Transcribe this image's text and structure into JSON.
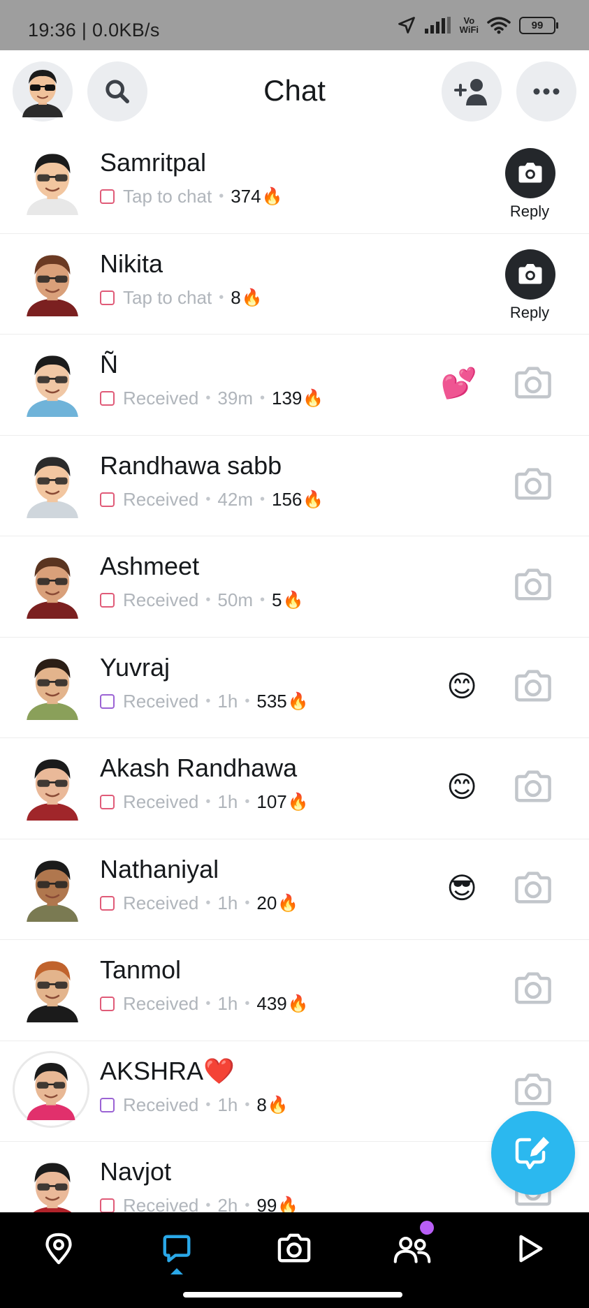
{
  "status_bar": {
    "time": "19:36 | 0.0KB/s",
    "vowifi": "Vo\nWiFi",
    "battery": "99"
  },
  "header": {
    "title": "Chat"
  },
  "chats": [
    {
      "name": "Samritpal",
      "status": "Tap to chat",
      "time": "",
      "streak": "374",
      "action": "reply",
      "emoji": "",
      "box_color": "red",
      "avatar_skin": "#f2c6a0",
      "avatar_hair": "#1b1b1b",
      "avatar_shirt": "#e8e8e8"
    },
    {
      "name": "Nikita",
      "status": "Tap to chat",
      "time": "",
      "streak": "8",
      "action": "reply",
      "emoji": "",
      "box_color": "red",
      "avatar_skin": "#d9a07a",
      "avatar_hair": "#6b3a23",
      "avatar_shirt": "#7b2020"
    },
    {
      "name": "Ñ",
      "status": "Received",
      "time": "39m",
      "streak": "139",
      "action": "camera",
      "emoji": "💕",
      "box_color": "red",
      "avatar_skin": "#f0c7a5",
      "avatar_hair": "#1b1b1b",
      "avatar_shirt": "#6fb3d9"
    },
    {
      "name": "Randhawa sabb",
      "status": "Received",
      "time": "42m",
      "streak": "156",
      "action": "camera",
      "emoji": "",
      "box_color": "red",
      "avatar_skin": "#f2c6a0",
      "avatar_hair": "#2b2b2b",
      "avatar_shirt": "#cfd6dc"
    },
    {
      "name": "Ashmeet",
      "status": "Received",
      "time": "50m",
      "streak": "5",
      "action": "camera",
      "emoji": "",
      "box_color": "red",
      "avatar_skin": "#d9a07a",
      "avatar_hair": "#5a3420",
      "avatar_shirt": "#7b2020"
    },
    {
      "name": "Yuvraj",
      "status": "Received",
      "time": "1h",
      "streak": "535",
      "action": "camera",
      "emoji": "😊",
      "box_color": "purple",
      "avatar_skin": "#e3b48c",
      "avatar_hair": "#2b1e16",
      "avatar_shirt": "#8aa05a"
    },
    {
      "name": "Akash Randhawa",
      "status": "Received",
      "time": "1h",
      "streak": "107",
      "action": "camera",
      "emoji": "😊",
      "box_color": "red",
      "avatar_skin": "#eab999",
      "avatar_hair": "#1b1b1b",
      "avatar_shirt": "#a0262a"
    },
    {
      "name": "Nathaniyal",
      "status": "Received",
      "time": "1h",
      "streak": "20",
      "action": "camera",
      "emoji": "😎",
      "box_color": "red",
      "avatar_skin": "#b0774e",
      "avatar_hair": "#1b1b1b",
      "avatar_shirt": "#7a7a52"
    },
    {
      "name": "Tanmol",
      "status": "Received",
      "time": "1h",
      "streak": "439",
      "action": "camera",
      "emoji": "",
      "box_color": "red",
      "avatar_skin": "#e3b48c",
      "avatar_hair": "#c0632d",
      "avatar_shirt": "#1b1b1b"
    },
    {
      "name": "AKSHRA❤️",
      "status": "Received",
      "time": "1h",
      "streak": "8",
      "action": "camera",
      "emoji": "",
      "box_color": "purple",
      "avatar_skin": "#e8b895",
      "avatar_hair": "#1b1b1b",
      "avatar_shirt": "#e1306c",
      "ring": true
    },
    {
      "name": "Navjot",
      "status": "Received",
      "time": "2h",
      "streak": "99",
      "action": "camera",
      "emoji": "",
      "box_color": "red",
      "avatar_skin": "#eab999",
      "avatar_hair": "#1b1b1b",
      "avatar_shirt": "#b0232a"
    }
  ],
  "labels": {
    "reply": "Reply"
  },
  "colors": {
    "accent_blue": "#2bb8ef",
    "box_red": "#e05b78",
    "box_purple": "#9b63d4",
    "nav_active": "#2aa8e8",
    "friends_badge": "#b85ef5"
  },
  "icons": {
    "header": [
      "bitmoji-avatar",
      "search-icon",
      "add-friend-icon",
      "more-icon"
    ],
    "nav": [
      "map-icon",
      "chat-icon",
      "camera-icon",
      "friends-icon",
      "play-icon"
    ],
    "fab": "new-chat-icon"
  }
}
